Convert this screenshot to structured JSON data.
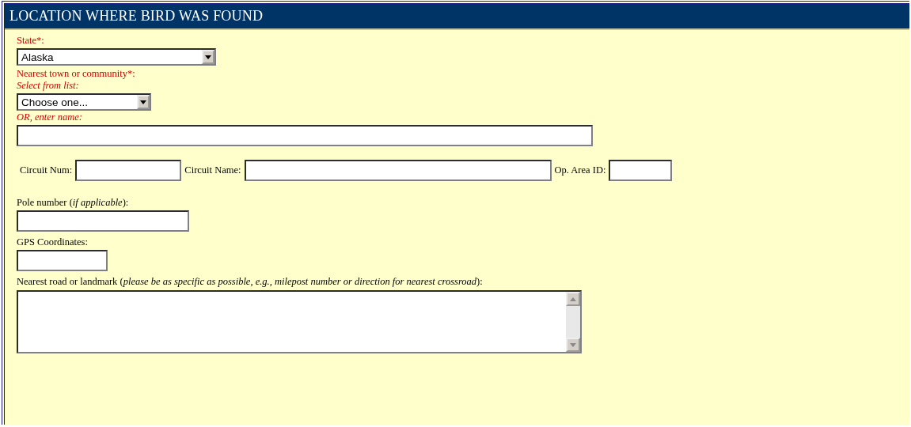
{
  "section": {
    "title": "LOCATION WHERE BIRD WAS FOUND"
  },
  "state": {
    "label": "State*:",
    "required": true,
    "select": {
      "value": "Alaska"
    }
  },
  "town": {
    "label": "Nearest town or community*:",
    "required": true,
    "select_hint": "Select from list:",
    "select": {
      "value": "Choose one..."
    },
    "name_hint": "OR, enter name:"
  },
  "circuit": [
    {
      "label": "Circuit Num:"
    },
    {
      "label": "Circuit Name:"
    },
    {
      "label": "Op. Area ID:"
    }
  ],
  "pole": {
    "label": "Pole number (*if applicable*):",
    "required": false
  },
  "gps": {
    "label": "GPS Coordinates:",
    "required": false
  },
  "road": {
    "label": "Nearest road or landmark (*please be as specific as possible, e.g., milepost number or direction for nearest crossroad*):",
    "required": false
  }
}
